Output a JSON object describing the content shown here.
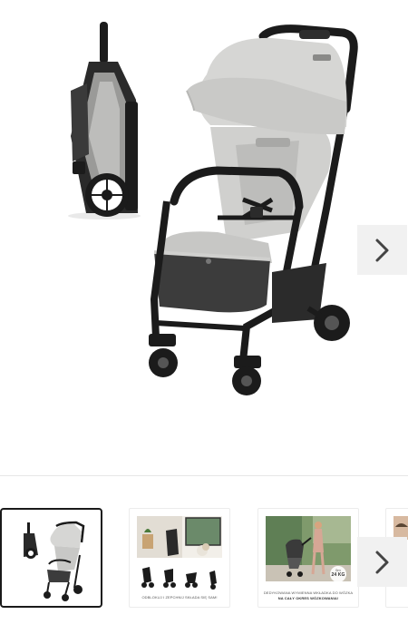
{
  "main": {
    "product": "stroller-product-photo",
    "next_icon": "chevron-right-icon"
  },
  "thumbnails": [
    {
      "id": "thumb-stroller",
      "selected": true
    },
    {
      "id": "thumb-folding-steps",
      "selected": false,
      "caption": "ODBLOKUJ I ZEPCHNIJ SKŁADA SIĘ SAM!"
    },
    {
      "id": "thumb-lifestyle",
      "selected": false,
      "caption_line1": "DEDYKOWANA WYMIENNA WKŁADKA DO WÓZKA",
      "caption_line2": "NA CAŁY OKRES WÓZKOWANIA!",
      "badge_line1": "0m",
      "badge_line2": "24 KG"
    },
    {
      "id": "thumb-partial",
      "selected": false
    }
  ],
  "colors": {
    "canopy": "#cfcfcd",
    "seat": "#bdbdbb",
    "frame": "#1b1b1b",
    "basket": "#3a3a3a",
    "button_bg": "#f1f1f1",
    "chevron": "#444444"
  }
}
